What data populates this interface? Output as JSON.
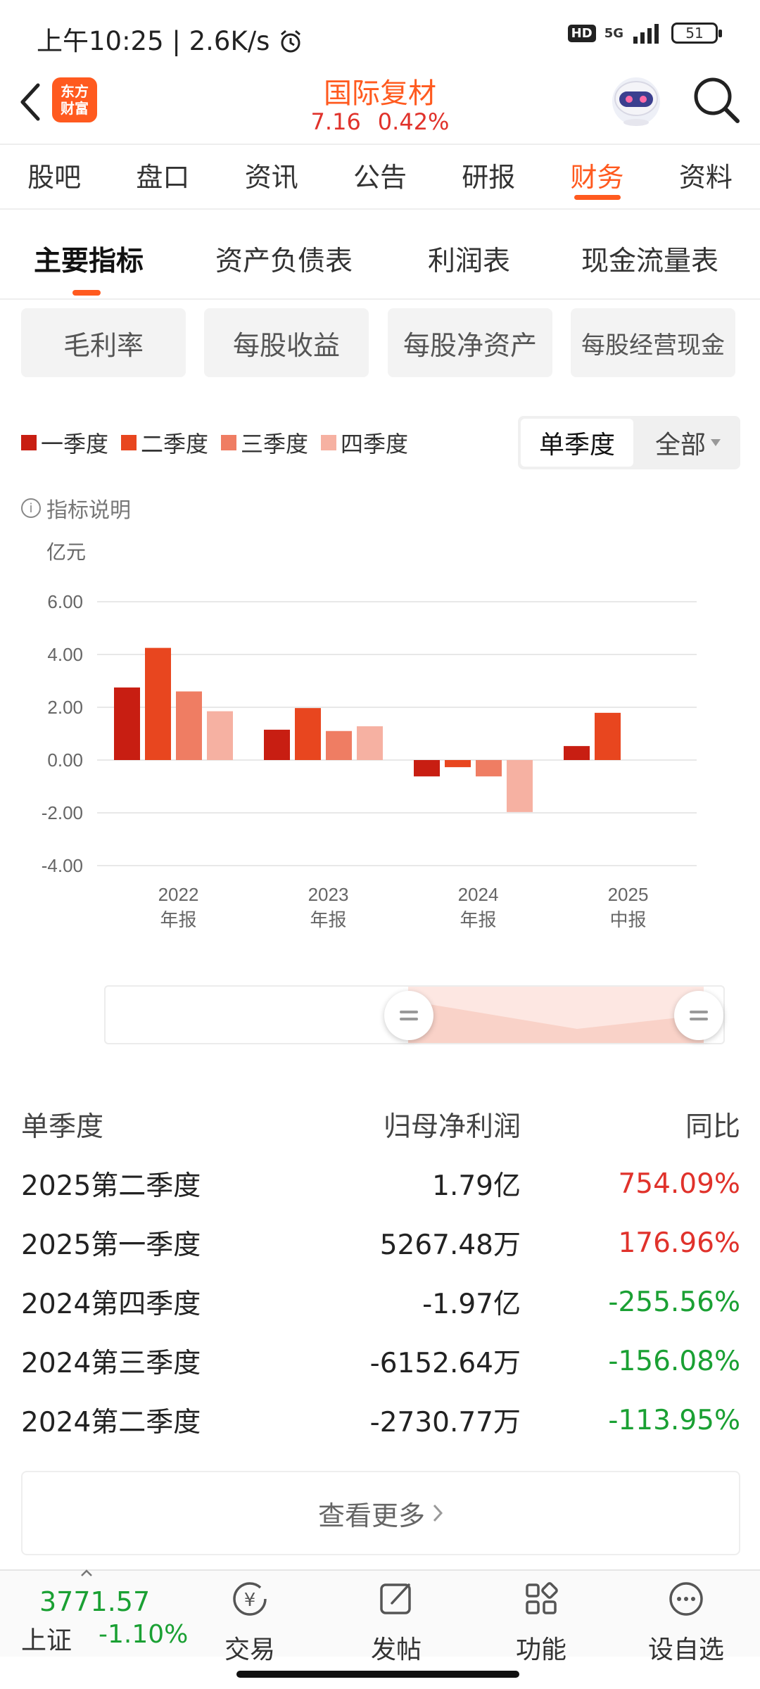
{
  "status_bar": {
    "time": "上午10:25 | 2.6K/s",
    "hd": "HD",
    "network": "5G",
    "battery": "51"
  },
  "header": {
    "logo_text": "东方财富",
    "stock_name": "国际复材",
    "price": "7.16",
    "change_pct": "0.42%"
  },
  "main_tabs": [
    "股吧",
    "盘口",
    "资讯",
    "公告",
    "研报",
    "财务",
    "资料"
  ],
  "main_tab_active": "财务",
  "sub_tabs": [
    "主要指标",
    "资产负债表",
    "利润表",
    "现金流量表"
  ],
  "chips": [
    "毛利率",
    "每股收益",
    "每股净资产",
    "每股经营现金"
  ],
  "legend": {
    "q1": "一季度",
    "q2": "二季度",
    "q3": "三季度",
    "q4": "四季度"
  },
  "period_toggle": {
    "single": "单季度",
    "all": "全部"
  },
  "info_note": "指标说明",
  "colors": {
    "accent": "#ff5a1f",
    "q1": "#c81e12",
    "q2": "#e8461f",
    "q3": "#ef7d63",
    "q4": "#f6b1a2",
    "up": "#e0322b",
    "down": "#1aa033"
  },
  "chart_data": {
    "type": "bar",
    "ylabel": "亿元",
    "ylim": [
      -4,
      6
    ],
    "yticks": [
      "6.00",
      "4.00",
      "2.00",
      "0.00",
      "-2.00",
      "-4.00"
    ],
    "categories": [
      {
        "year": "2022",
        "period": "年报"
      },
      {
        "year": "2023",
        "period": "年报"
      },
      {
        "year": "2024",
        "period": "年报"
      },
      {
        "year": "2025",
        "period": "中报"
      }
    ],
    "series": [
      {
        "name": "一季度",
        "values": [
          2.75,
          1.15,
          -0.62,
          0.53
        ]
      },
      {
        "name": "二季度",
        "values": [
          4.25,
          1.97,
          -0.27,
          1.79
        ]
      },
      {
        "name": "三季度",
        "values": [
          2.6,
          1.1,
          -0.62,
          null
        ]
      },
      {
        "name": "四季度",
        "values": [
          1.85,
          1.28,
          -1.97,
          null
        ]
      }
    ],
    "grid": true
  },
  "table": {
    "headers": [
      "单季度",
      "归母净利润",
      "同比"
    ],
    "rows": [
      {
        "period": "2025第二季度",
        "value": "1.79亿",
        "yoy": "754.09%",
        "dir": "up"
      },
      {
        "period": "2025第一季度",
        "value": "5267.48万",
        "yoy": "176.96%",
        "dir": "up"
      },
      {
        "period": "2024第四季度",
        "value": "-1.97亿",
        "yoy": "-255.56%",
        "dir": "down"
      },
      {
        "period": "2024第三季度",
        "value": "-6152.64万",
        "yoy": "-156.08%",
        "dir": "down"
      },
      {
        "period": "2024第二季度",
        "value": "-2730.77万",
        "yoy": "-113.95%",
        "dir": "down"
      }
    ]
  },
  "more_label": "查看更多",
  "bottom_bar": {
    "index_value": "3771.57",
    "index_name": "上证",
    "index_change": "-1.10%",
    "trade": "交易",
    "post": "发帖",
    "functions": "功能",
    "watchlist": "设自选"
  }
}
